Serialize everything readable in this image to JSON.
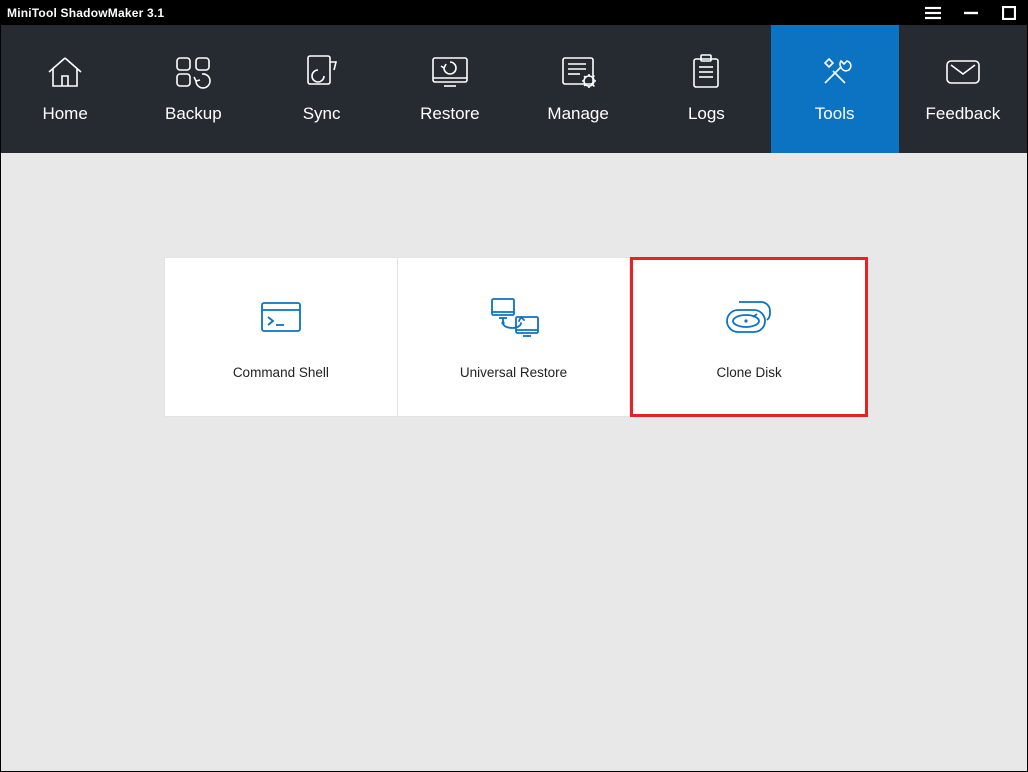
{
  "window": {
    "title": "MiniTool ShadowMaker 3.1"
  },
  "nav": {
    "items": [
      {
        "label": "Home"
      },
      {
        "label": "Backup"
      },
      {
        "label": "Sync"
      },
      {
        "label": "Restore"
      },
      {
        "label": "Manage"
      },
      {
        "label": "Logs"
      },
      {
        "label": "Tools",
        "active": true
      },
      {
        "label": "Feedback"
      }
    ]
  },
  "tools": {
    "cards": [
      {
        "label": "Command Shell"
      },
      {
        "label": "Universal Restore"
      },
      {
        "label": "Clone Disk",
        "highlight": true
      }
    ]
  },
  "colors": {
    "accent": "#0b73c2",
    "highlight": "#e32424",
    "navbg": "#262b31",
    "bg": "#e8e8e8"
  }
}
